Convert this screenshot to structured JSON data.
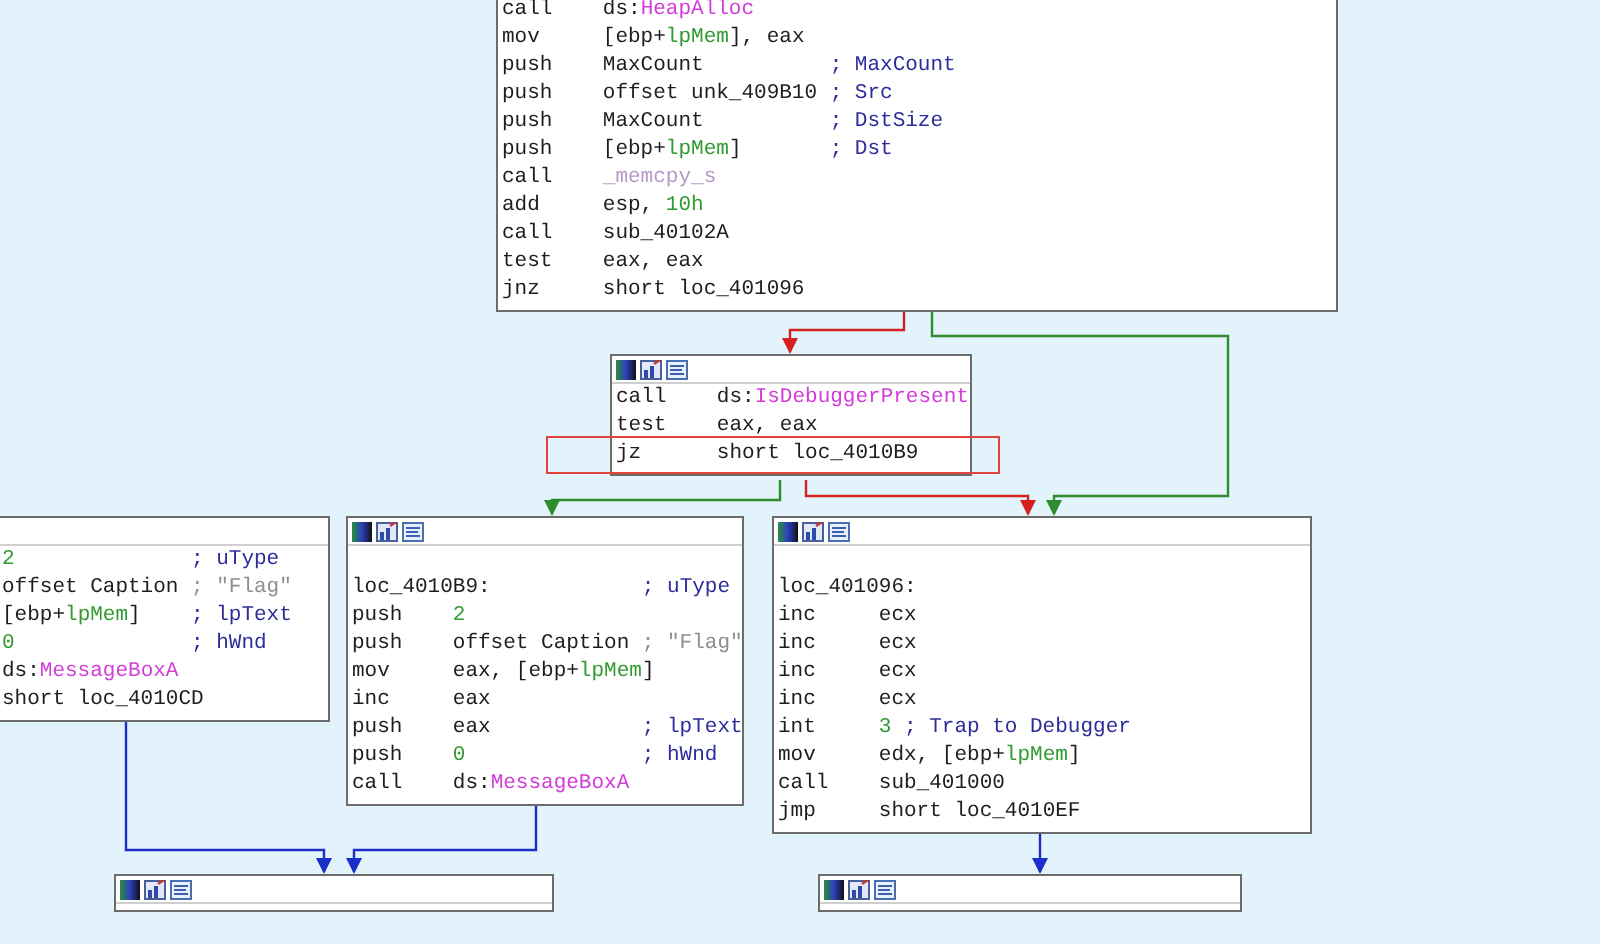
{
  "nodes": [
    {
      "lines": [
        {
          "mnemonic": "call",
          "operand": [
            {
              "text": "ds:",
              "kind": "text"
            },
            {
              "text": "HeapAlloc",
              "kind": "import"
            }
          ],
          "highlighted": false
        },
        {
          "mnemonic": "mov",
          "operand": [
            {
              "text": "[ebp+",
              "kind": "text"
            },
            {
              "text": "lpMem",
              "kind": "var"
            },
            {
              "text": "], eax",
              "kind": "text"
            }
          ],
          "highlighted": false
        },
        {
          "mnemonic": "push",
          "operand": [
            {
              "text": "MaxCount",
              "kind": "text"
            }
          ],
          "comment": {
            "text": "; MaxCount",
            "kind": "comment"
          },
          "highlighted": false
        },
        {
          "mnemonic": "push",
          "operand": [
            {
              "text": "offset unk_409B10",
              "kind": "text"
            }
          ],
          "comment": {
            "text": "; Src",
            "kind": "comment"
          },
          "highlighted": false
        },
        {
          "mnemonic": "push",
          "operand": [
            {
              "text": "MaxCount",
              "kind": "text"
            }
          ],
          "comment": {
            "text": "; DstSize",
            "kind": "comment"
          },
          "highlighted": false
        },
        {
          "mnemonic": "push",
          "operand": [
            {
              "text": "[ebp+",
              "kind": "text"
            },
            {
              "text": "lpMem",
              "kind": "var"
            },
            {
              "text": "]",
              "kind": "text"
            }
          ],
          "comment": {
            "text": "; Dst",
            "kind": "comment"
          },
          "highlighted": false
        },
        {
          "mnemonic": "call",
          "operand": [
            {
              "text": "_memcpy_s",
              "kind": "lib"
            }
          ],
          "highlighted": false
        },
        {
          "mnemonic": "add",
          "operand": [
            {
              "text": "esp, ",
              "kind": "text"
            },
            {
              "text": "10h",
              "kind": "num"
            }
          ],
          "highlighted": false
        },
        {
          "mnemonic": "call",
          "operand": [
            {
              "text": "sub_40102A",
              "kind": "text"
            }
          ],
          "highlighted": false
        },
        {
          "mnemonic": "test",
          "operand": [
            {
              "text": "eax, eax",
              "kind": "text"
            }
          ],
          "highlighted": false
        },
        {
          "mnemonic": "jnz",
          "operand": [
            {
              "text": "short loc_401096",
              "kind": "text"
            }
          ],
          "highlighted": false
        }
      ]
    },
    {
      "toolbar": true,
      "lines": [
        {
          "mnemonic": "call",
          "operand": [
            {
              "text": "ds:",
              "kind": "text"
            },
            {
              "text": "IsDebuggerPresent",
              "kind": "import"
            }
          ],
          "highlighted": false
        },
        {
          "mnemonic": "test",
          "operand": [
            {
              "text": "eax, eax",
              "kind": "text"
            }
          ],
          "highlighted": false
        },
        {
          "mnemonic": "jz",
          "operand": [
            {
              "text": "short loc_4010B9",
              "kind": "text"
            }
          ],
          "highlighted": true
        }
      ]
    },
    {
      "lines": [
        {
          "operand": [
            {
              "text": "2",
              "kind": "num"
            }
          ],
          "comment": {
            "text": "; uType",
            "kind": "comment"
          },
          "highlighted": false
        },
        {
          "operand": [
            {
              "text": "offset Caption",
              "kind": "text"
            }
          ],
          "comment": {
            "text": "; \"Flag\"",
            "kind": "string"
          },
          "highlighted": false
        },
        {
          "operand": [
            {
              "text": "[ebp+",
              "kind": "text"
            },
            {
              "text": "lpMem",
              "kind": "var"
            },
            {
              "text": "]",
              "kind": "text"
            }
          ],
          "comment": {
            "text": "; lpText",
            "kind": "comment"
          },
          "highlighted": false
        },
        {
          "operand": [
            {
              "text": "0",
              "kind": "num"
            }
          ],
          "comment": {
            "text": "; hWnd",
            "kind": "comment"
          },
          "highlighted": false
        },
        {
          "operand": [
            {
              "text": "ds:",
              "kind": "text"
            },
            {
              "text": "MessageBoxA",
              "kind": "import"
            }
          ],
          "highlighted": false
        },
        {
          "operand": [
            {
              "text": "short loc_4010CD",
              "kind": "text"
            }
          ],
          "highlighted": false
        }
      ]
    },
    {
      "toolbar": true,
      "lines": [
        {
          "label": "loc_4010B9:",
          "comment": {
            "text": "; uType",
            "kind": "comment"
          },
          "highlighted": false
        },
        {
          "mnemonic": "push",
          "operand": [
            {
              "text": "2",
              "kind": "num"
            }
          ],
          "highlighted": false
        },
        {
          "mnemonic": "push",
          "operand": [
            {
              "text": "offset Caption",
              "kind": "text"
            }
          ],
          "comment": {
            "text": "; \"Flag\"",
            "kind": "string"
          },
          "highlighted": false
        },
        {
          "mnemonic": "mov",
          "operand": [
            {
              "text": "eax, [ebp+",
              "kind": "text"
            },
            {
              "text": "lpMem",
              "kind": "var"
            },
            {
              "text": "]",
              "kind": "text"
            }
          ],
          "highlighted": false
        },
        {
          "mnemonic": "inc",
          "operand": [
            {
              "text": "eax",
              "kind": "text"
            }
          ],
          "highlighted": false
        },
        {
          "mnemonic": "push",
          "operand": [
            {
              "text": "eax",
              "kind": "text"
            }
          ],
          "comment": {
            "text": "; lpText",
            "kind": "comment"
          },
          "highlighted": false
        },
        {
          "mnemonic": "push",
          "operand": [
            {
              "text": "0",
              "kind": "num"
            }
          ],
          "comment": {
            "text": "; hWnd",
            "kind": "comment"
          },
          "highlighted": false
        },
        {
          "mnemonic": "call",
          "operand": [
            {
              "text": "ds:",
              "kind": "text"
            },
            {
              "text": "MessageBoxA",
              "kind": "import"
            }
          ],
          "highlighted": false
        }
      ]
    },
    {
      "toolbar": true,
      "lines": [
        {
          "label": "loc_401096:",
          "highlighted": false
        },
        {
          "mnemonic": "inc",
          "operand": [
            {
              "text": "ecx",
              "kind": "text"
            }
          ],
          "highlighted": false
        },
        {
          "mnemonic": "inc",
          "operand": [
            {
              "text": "ecx",
              "kind": "text"
            }
          ],
          "highlighted": false
        },
        {
          "mnemonic": "inc",
          "operand": [
            {
              "text": "ecx",
              "kind": "text"
            }
          ],
          "highlighted": false
        },
        {
          "mnemonic": "inc",
          "operand": [
            {
              "text": "ecx",
              "kind": "text"
            }
          ],
          "highlighted": false
        },
        {
          "mnemonic": "int",
          "operand": [
            {
              "text": "3",
              "kind": "num"
            }
          ],
          "comment": {
            "text": "; Trap to Debugger",
            "kind": "comment"
          },
          "highlighted": false
        },
        {
          "mnemonic": "mov",
          "operand": [
            {
              "text": "edx, [ebp+",
              "kind": "text"
            },
            {
              "text": "lpMem",
              "kind": "var"
            },
            {
              "text": "]",
              "kind": "text"
            }
          ],
          "highlighted": false
        },
        {
          "mnemonic": "call",
          "operand": [
            {
              "text": "sub_401000",
              "kind": "text"
            }
          ],
          "highlighted": false
        },
        {
          "mnemonic": "jmp",
          "operand": [
            {
              "text": "short loc_4010EF",
              "kind": "text"
            }
          ],
          "highlighted": false
        }
      ]
    },
    {
      "toolbar": true
    },
    {
      "toolbar": true
    }
  ],
  "edges": [
    {
      "kind": "false"
    },
    {
      "kind": "true"
    },
    {
      "kind": "true"
    },
    {
      "kind": "false"
    },
    {
      "kind": "jump"
    },
    {
      "kind": "jump"
    },
    {
      "kind": "jump"
    }
  ]
}
